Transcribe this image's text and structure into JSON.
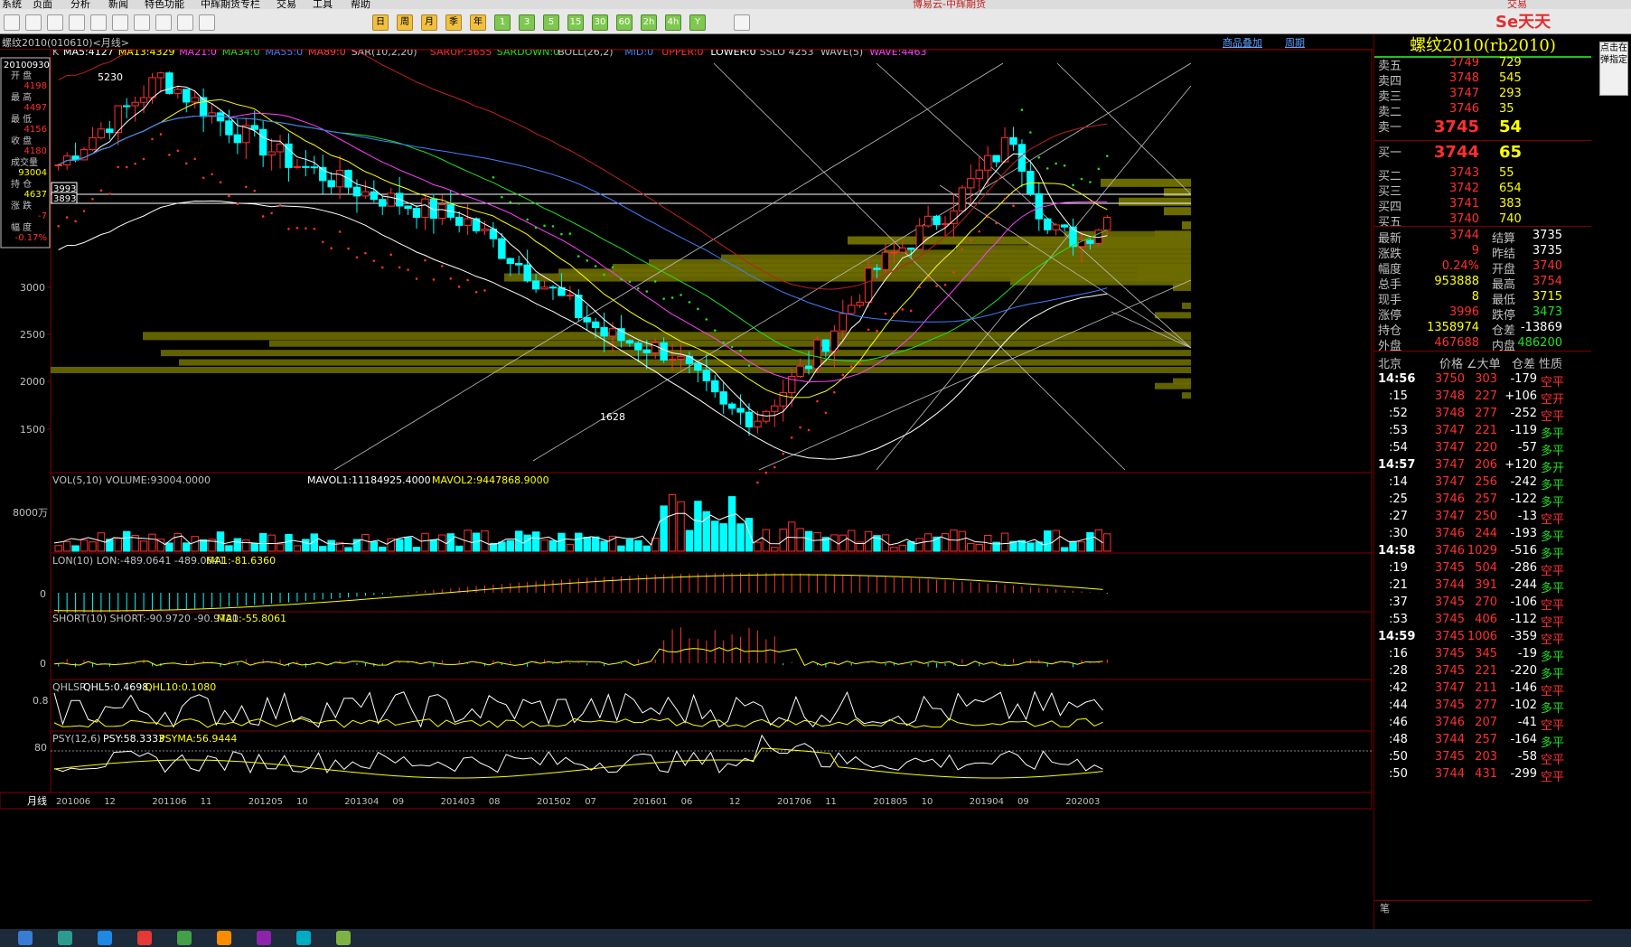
{
  "menu": [
    "系统",
    "页面",
    "分析",
    "新闻",
    "特色功能",
    "中辉期货专栏",
    "交易",
    "工具",
    "帮助"
  ],
  "window_title": "博易云-中辉期货",
  "brand": "Se天天",
  "trade_button": "交易",
  "toolbar_periods": [
    "日",
    "周",
    "月",
    "季",
    "年",
    "1",
    "3",
    "5",
    "15",
    "30",
    "60",
    "2h",
    "4h",
    "Y"
  ],
  "chart_header": {
    "title": "螺纹2010(010610)<月线>",
    "links": [
      "商品叠加",
      "周期"
    ]
  },
  "indicator_line": {
    "k": "K",
    "ma": [
      {
        "text": "MA5:4127",
        "color": "#ffffff"
      },
      {
        "text": "MA13:4329",
        "color": "#ffff00"
      },
      {
        "text": "MA21:0",
        "color": "#ff40ff"
      },
      {
        "text": "MA34:0",
        "color": "#20e020"
      },
      {
        "text": "MA55:0",
        "color": "#4080ff"
      },
      {
        "text": "MA89:0",
        "color": "#ff4040"
      },
      {
        "text": "SAR(10,2,20)",
        "color": "#c0c0c0"
      },
      {
        "text": "SARUP:3655",
        "color": "#ff3030"
      },
      {
        "text": "SARDOWN:0",
        "color": "#20e020"
      },
      {
        "text": "BOLL(26,2)",
        "color": "#c0c0c0"
      },
      {
        "text": "MID:0",
        "color": "#4080ff"
      },
      {
        "text": "UPPER:0",
        "color": "#ff3030"
      },
      {
        "text": "LOWER:0",
        "color": "#ffffff"
      },
      {
        "text": "SSLO 4253",
        "color": "#c0c0c0"
      },
      {
        "text": "WAVE(5)",
        "color": "#c0c0c0"
      },
      {
        "text": "WAVE:4463",
        "color": "#ff40ff"
      }
    ]
  },
  "info_panel": {
    "date": "20100930",
    "fields": [
      {
        "label": "开  盘",
        "value": "4198"
      },
      {
        "label": "最  高",
        "value": "4497"
      },
      {
        "label": "最  低",
        "value": "4156"
      },
      {
        "label": "收  盘",
        "value": "4180"
      },
      {
        "label": "成交量",
        "value": "93004"
      },
      {
        "label": "持  仓",
        "value": "4637"
      },
      {
        "label": "涨  跌",
        "value": "-7"
      },
      {
        "label": "幅  度",
        "value": "-0.17%"
      }
    ]
  },
  "price_axis": [
    "3000",
    "2500",
    "2000",
    "1500"
  ],
  "price_labels": {
    "high": "5230",
    "low": "1628",
    "box1": "3993",
    "box2": "3893"
  },
  "sub_panels": {
    "vol": {
      "title": "VOL(5,10) VOLUME:93004.0000",
      "m1": "MAVOL1:11184925.4000",
      "m2": "MAVOL2:9447868.9000",
      "axis": "8000万"
    },
    "lon": {
      "title": "LON(10) LON:-489.0641 -489.0641",
      "m1": "MA1:-81.6360",
      "axis": "0"
    },
    "short": {
      "title": "SHORT(10) SHORT:-90.9720 -90.9720",
      "m1": "MA1:-55.8061",
      "axis": "0"
    },
    "qhlsr": {
      "title": "QHLSR",
      "m1": "QHL5:0.4698",
      "m2": "QHL10:0.1080",
      "axis": "0.8"
    },
    "psy": {
      "title": "PSY(12,6)",
      "m1": "PSY:58.3333",
      "m2": "PSYMA:56.9444",
      "axis": "80"
    }
  },
  "x_axis": {
    "label": "月线",
    "ticks": [
      "201006",
      "12",
      "201106",
      "11",
      "201205",
      "10",
      "201304",
      "09",
      "201403",
      "08",
      "201502",
      "07",
      "201601",
      "06",
      "12",
      "201706",
      "11",
      "201805",
      "10",
      "201904",
      "09",
      "202003"
    ]
  },
  "quote": {
    "title": "螺纹2010(rb2010)",
    "asks": [
      {
        "label": "卖五",
        "price": "3749",
        "vol": "729"
      },
      {
        "label": "卖四",
        "price": "3748",
        "vol": "545"
      },
      {
        "label": "卖三",
        "price": "3747",
        "vol": "293"
      },
      {
        "label": "卖二",
        "price": "3746",
        "vol": "35"
      },
      {
        "label": "卖一",
        "price": "3745",
        "vol": "54"
      }
    ],
    "bids": [
      {
        "label": "买一",
        "price": "3744",
        "vol": "65"
      },
      {
        "label": "买二",
        "price": "3743",
        "vol": "55"
      },
      {
        "label": "买三",
        "price": "3742",
        "vol": "654"
      },
      {
        "label": "买四",
        "price": "3741",
        "vol": "383"
      },
      {
        "label": "买五",
        "price": "3740",
        "vol": "740"
      }
    ],
    "stats": [
      {
        "l1": "最新",
        "v1": "3744",
        "c1": "red",
        "l2": "结算",
        "v2": "3735",
        "c2": "wht"
      },
      {
        "l1": "涨跌",
        "v1": "9",
        "c1": "red",
        "l2": "昨结",
        "v2": "3735",
        "c2": "wht"
      },
      {
        "l1": "幅度",
        "v1": "0.24%",
        "c1": "red",
        "l2": "开盘",
        "v2": "3740",
        "c2": "red"
      },
      {
        "l1": "总手",
        "v1": "953888",
        "c1": "yel",
        "l2": "最高",
        "v2": "3754",
        "c2": "red"
      },
      {
        "l1": "现手",
        "v1": "8",
        "c1": "yel",
        "l2": "最低",
        "v2": "3715",
        "c2": "yel"
      },
      {
        "l1": "涨停",
        "v1": "3996",
        "c1": "red",
        "l2": "跌停",
        "v2": "3473",
        "c2": "grn"
      },
      {
        "l1": "持仓",
        "v1": "1358974",
        "c1": "yel",
        "l2": "仓差",
        "v2": "-13869",
        "c2": "wht"
      },
      {
        "l1": "外盘",
        "v1": "467688",
        "c1": "red",
        "l2": "内盘",
        "v2": "486200",
        "c2": "grn"
      }
    ],
    "ticks_header": [
      "北京",
      "价格",
      "∠大单",
      "仓差",
      "性质"
    ],
    "ticks": [
      {
        "t": "14:56",
        "p": "3750",
        "v": "303",
        "d": "-179",
        "n": "空平",
        "major": true
      },
      {
        "t": ":15",
        "p": "3748",
        "v": "227",
        "d": "+106",
        "n": "空开",
        "major": false
      },
      {
        "t": ":52",
        "p": "3748",
        "v": "277",
        "d": "-252",
        "n": "空平",
        "major": false
      },
      {
        "t": ":53",
        "p": "3747",
        "v": "221",
        "d": "-119",
        "n": "多平",
        "major": false
      },
      {
        "t": ":54",
        "p": "3747",
        "v": "220",
        "d": "-57",
        "n": "多平",
        "major": false
      },
      {
        "t": "14:57",
        "p": "3747",
        "v": "206",
        "d": "+120",
        "n": "多开",
        "major": true
      },
      {
        "t": ":14",
        "p": "3747",
        "v": "256",
        "d": "-242",
        "n": "多平",
        "major": false
      },
      {
        "t": ":25",
        "p": "3746",
        "v": "257",
        "d": "-122",
        "n": "多平",
        "major": false
      },
      {
        "t": ":27",
        "p": "3747",
        "v": "250",
        "d": "-13",
        "n": "空平",
        "major": false
      },
      {
        "t": ":30",
        "p": "3746",
        "v": "244",
        "d": "-193",
        "n": "多平",
        "major": false
      },
      {
        "t": "14:58",
        "p": "3746",
        "v": "1029",
        "d": "-516",
        "n": "多平",
        "major": true
      },
      {
        "t": ":19",
        "p": "3745",
        "v": "504",
        "d": "-286",
        "n": "空平",
        "major": false
      },
      {
        "t": ":21",
        "p": "3744",
        "v": "391",
        "d": "-244",
        "n": "多平",
        "major": false
      },
      {
        "t": ":37",
        "p": "3745",
        "v": "270",
        "d": "-106",
        "n": "空平",
        "major": false
      },
      {
        "t": ":53",
        "p": "3745",
        "v": "406",
        "d": "-112",
        "n": "空平",
        "major": false
      },
      {
        "t": "14:59",
        "p": "3745",
        "v": "1006",
        "d": "-359",
        "n": "空平",
        "major": true
      },
      {
        "t": ":16",
        "p": "3745",
        "v": "345",
        "d": "-19",
        "n": "多平",
        "major": false
      },
      {
        "t": ":28",
        "p": "3745",
        "v": "221",
        "d": "-220",
        "n": "多平",
        "major": false
      },
      {
        "t": ":42",
        "p": "3747",
        "v": "211",
        "d": "-146",
        "n": "空平",
        "major": false
      },
      {
        "t": ":44",
        "p": "3745",
        "v": "277",
        "d": "-102",
        "n": "多平",
        "major": false
      },
      {
        "t": ":46",
        "p": "3746",
        "v": "207",
        "d": "-41",
        "n": "空平",
        "major": false
      },
      {
        "t": ":48",
        "p": "3744",
        "v": "257",
        "d": "-164",
        "n": "多平",
        "major": false
      },
      {
        "t": ":50",
        "p": "3745",
        "v": "203",
        "d": "-58",
        "n": "空平",
        "major": false
      },
      {
        "t": ":50",
        "p": "3744",
        "v": "431",
        "d": "-299",
        "n": "空平",
        "major": false
      }
    ],
    "footer_tab": "笔"
  },
  "side_button": "点击在弹指定"
}
